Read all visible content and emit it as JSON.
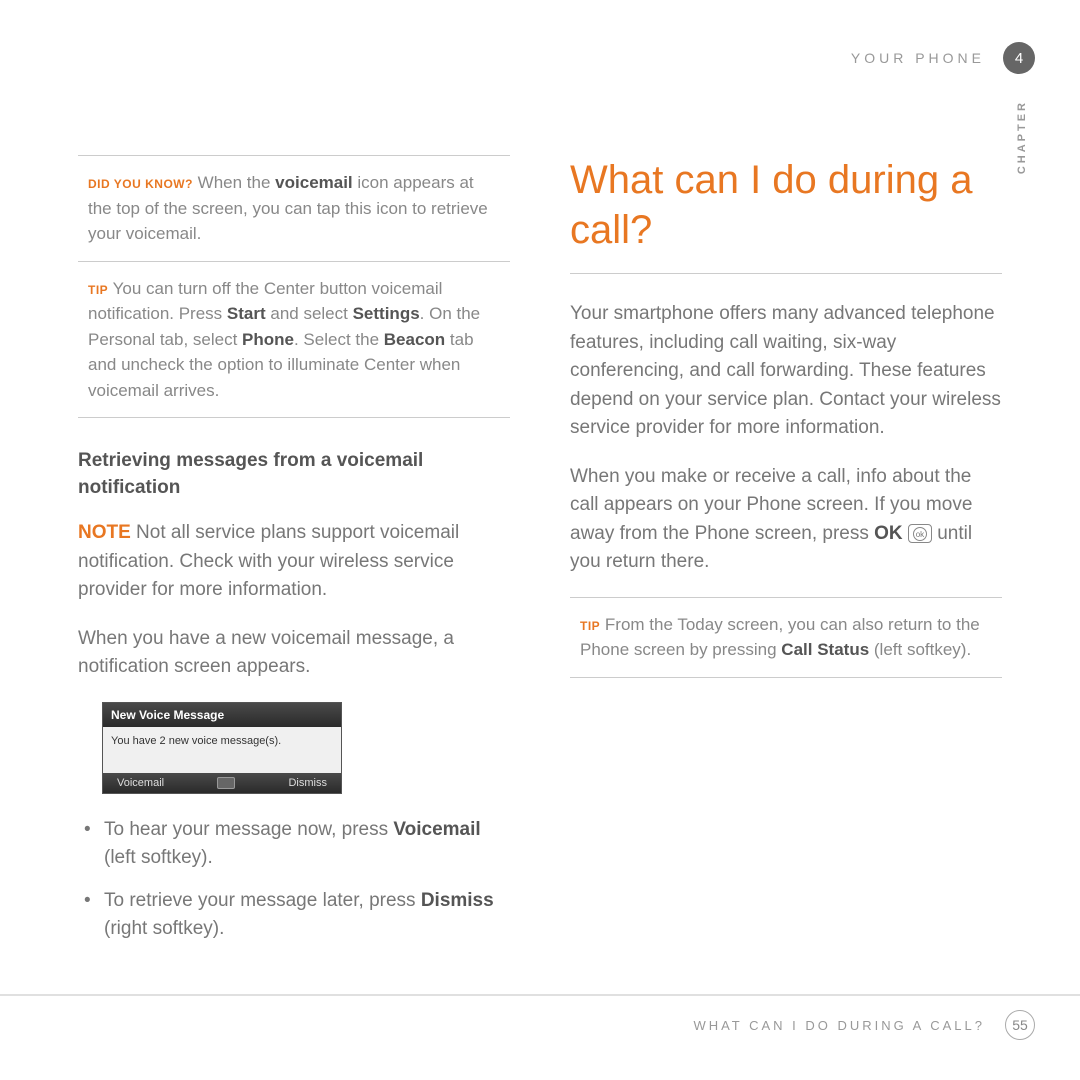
{
  "header": {
    "section": "YOUR PHONE",
    "chapter_num": "4",
    "chapter_label": "CHAPTER"
  },
  "left": {
    "dyk": {
      "label": "DID YOU KNOW?",
      "t1": " When the ",
      "b1": "voicemail",
      "t2": " icon appears at the top of the screen, you can tap this icon to retrieve your voicemail."
    },
    "tip1": {
      "label": "TIP",
      "t1": " You can turn off the Center button voicemail notification. Press ",
      "b1": "Start",
      "t2": " and select ",
      "b2": "Settings",
      "t3": ". On the Personal tab, select ",
      "b3": "Phone",
      "t4": ". Select the ",
      "b4": "Beacon",
      "t5": " tab and uncheck the option to illuminate Center when voicemail arrives."
    },
    "heading": "Retrieving messages from a voicemail notification",
    "note": {
      "label": "NOTE",
      "text": " Not all service plans support voicemail notification. Check with your wireless service provider for more information."
    },
    "p2": "When you have a new voicemail message, a notification screen appears.",
    "ss": {
      "title": "New Voice Message",
      "body": "You have 2 new voice message(s).",
      "left_sk": "Voicemail",
      "right_sk": "Dismiss"
    },
    "li1": {
      "t1": "To hear your message now, press ",
      "b1": "Voicemail",
      "t2": " (left softkey)."
    },
    "li2": {
      "t1": "To retrieve your message later, press ",
      "b1": "Dismiss",
      "t2": " (right softkey)."
    }
  },
  "right": {
    "title": "What can I do during a call?",
    "p1": "Your smartphone offers many advanced telephone features, including call waiting, six-way conferencing, and call forwarding. These features depend on your service plan. Contact your wireless service provider for more information.",
    "p2": {
      "t1": "When you make or receive a call, info about the call appears on your Phone screen. If you move away from the Phone screen, press ",
      "b1": "OK",
      "t2": " until you return there."
    },
    "tip": {
      "label": "TIP",
      "t1": " From the Today screen, you can also return to the Phone screen by pressing ",
      "b1": "Call Status",
      "t2": " (left softkey)."
    }
  },
  "footer": {
    "label": "WHAT CAN I DO DURING A CALL?",
    "page": "55"
  }
}
